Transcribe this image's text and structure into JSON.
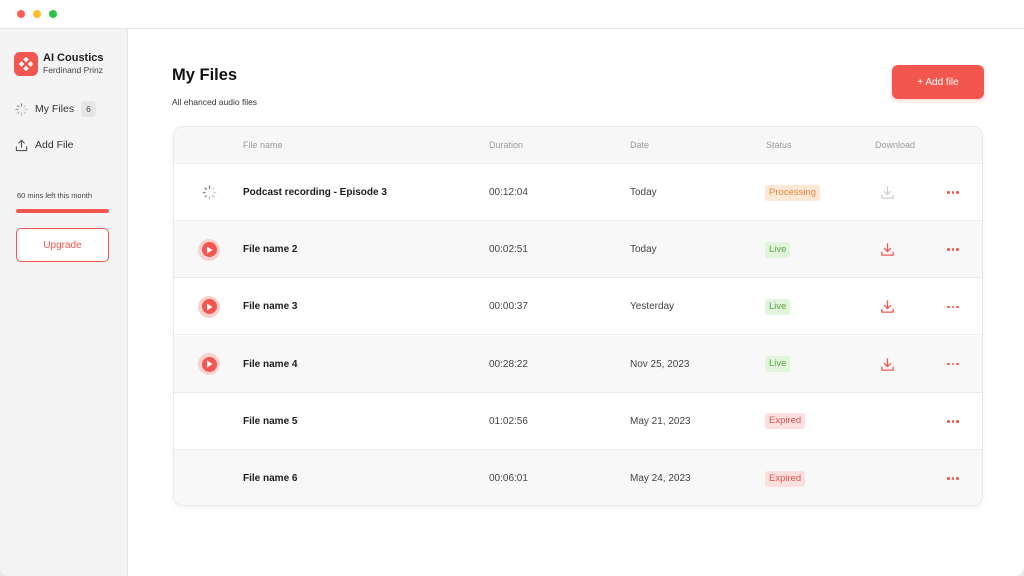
{
  "app": {
    "name": "AI Coustics",
    "user": "Ferdinand Prinz",
    "accent_color": "#f2564f"
  },
  "sidebar": {
    "nav": [
      {
        "label": "My Files",
        "icon": "loading-icon",
        "count": "6"
      },
      {
        "label": "Add File",
        "icon": "upload-icon"
      }
    ],
    "usage_text": "60 mins left this month",
    "usage_fraction": 1.0,
    "upgrade_label": "Upgrade"
  },
  "main": {
    "title": "My Files",
    "subtitle": "All ehanced audio files",
    "add_button_label": "+ Add file"
  },
  "table": {
    "columns": [
      "File name",
      "Duration",
      "Date",
      "Status",
      "Download"
    ],
    "status_colors": {
      "Processing": {
        "bg": "#fde8d6",
        "fg": "#e8893c"
      },
      "Live": {
        "bg": "#e2f5dc",
        "fg": "#5aa845"
      },
      "Expired": {
        "bg": "#fbe0df",
        "fg": "#e0544c"
      }
    },
    "rows": [
      {
        "lead_icon": "spinner-icon",
        "name": "Podcast recording - Episode 3",
        "duration": "00:12:04",
        "date": "Today",
        "status": "Processing",
        "download": "disabled"
      },
      {
        "lead_icon": "play-icon",
        "name": "File name 2",
        "duration": "00:02:51",
        "date": "Today",
        "status": "Live",
        "download": "enabled"
      },
      {
        "lead_icon": "play-icon",
        "name": "File name 3",
        "duration": "00:00:37",
        "date": "Yesterday",
        "status": "Live",
        "download": "enabled"
      },
      {
        "lead_icon": "play-icon",
        "name": "File name 4",
        "duration": "00:28:22",
        "date": "Nov 25, 2023",
        "status": "Live",
        "download": "enabled"
      },
      {
        "lead_icon": "none",
        "name": "File name 5",
        "duration": "01:02:56",
        "date": "May 21, 2023",
        "status": "Expired",
        "download": "none"
      },
      {
        "lead_icon": "none",
        "name": "File name 6",
        "duration": "00:06:01",
        "date": "May 24, 2023",
        "status": "Expired",
        "download": "none"
      }
    ]
  }
}
